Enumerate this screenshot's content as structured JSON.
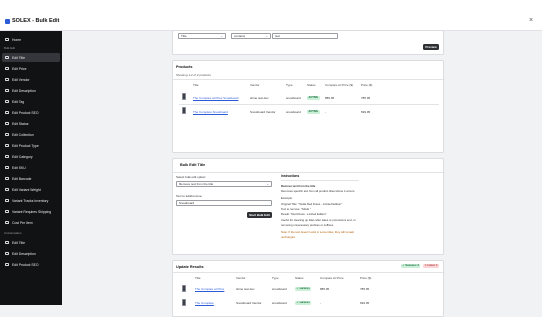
{
  "app": {
    "title": "SOLEX - Bulk Edit",
    "close_glyph": "×"
  },
  "sidebar": {
    "sections": [
      {
        "label": "Bulk Edit"
      },
      {
        "label": "AI Automation"
      }
    ],
    "items": [
      {
        "label": "Home",
        "icon": "home-icon"
      },
      {
        "label": "Edit Title",
        "icon": "edit-icon",
        "active": true
      },
      {
        "label": "Edit Price",
        "icon": "price-tag-icon"
      },
      {
        "label": "Edit Vendor",
        "icon": "vendor-icon"
      },
      {
        "label": "Edit Description",
        "icon": "description-icon"
      },
      {
        "label": "Edit Tag",
        "icon": "tag-icon"
      },
      {
        "label": "Edit Product SEO",
        "icon": "seo-icon"
      },
      {
        "label": "Edit Status",
        "icon": "status-icon"
      },
      {
        "label": "Edit Collection",
        "icon": "collection-icon"
      },
      {
        "label": "Edit Product Type",
        "icon": "product-type-icon"
      },
      {
        "label": "Edit Category",
        "icon": "category-icon"
      },
      {
        "label": "Edit SKU",
        "icon": "sku-icon"
      },
      {
        "label": "Edit Barcode",
        "icon": "barcode-icon"
      },
      {
        "label": "Edit Variant Weight",
        "icon": "weight-icon"
      },
      {
        "label": "Variant Tracks Inventory",
        "icon": "inventory-icon"
      },
      {
        "label": "Variant Requires Shipping",
        "icon": "shipping-icon"
      },
      {
        "label": "Cost Per Item",
        "icon": "cost-icon"
      },
      {
        "label": "Edit Title",
        "icon": "edit-icon"
      },
      {
        "label": "Edit Description",
        "icon": "description-icon"
      },
      {
        "label": "Edit Product SEO",
        "icon": "seo-icon"
      }
    ]
  },
  "filter": {
    "field": "Title",
    "operator": "contains",
    "value": "test",
    "preview_label": "Preview"
  },
  "products": {
    "title": "Products",
    "summary": "Showing 1-2 of 2 products",
    "columns": [
      "Title",
      "Vendor",
      "Type",
      "Status",
      "Compare At Price ($)",
      "Price ($)"
    ],
    "rows": [
      {
        "title": "The Compare at Price Snowboard",
        "vendor": "shine test dev",
        "type": "snowboard",
        "status": "ACTIVE",
        "compare": "885.95",
        "price": "785.95"
      },
      {
        "title": "The Complete Snowboard",
        "vendor": "Snowboard Vendor",
        "type": "snowboard",
        "status": "ACTIVE",
        "compare": "-",
        "price": "699.95"
      }
    ]
  },
  "bulk": {
    "title": "Bulk Edit Title",
    "option_label": "Select bulk edit option:",
    "option_value": "Remove text from the title",
    "text_label": "Text to add/remove:",
    "text_value": "Snowboard",
    "start_label": "Start Bulk Edit",
    "instructions_title": "Instructions",
    "instructions": [
      "Remove text from the title",
      "Removes specific text from all product titles where it occurs.",
      "Example:",
      "Original Title: \"SALE Red Dress - Limited Edition\"",
      "Text to remove: \"SALE \"",
      "Result: \"Red Dress - Limited Edition\"",
      "Useful for cleaning up titles after sales or promotions end, or",
      "removing unnecessary prefixes or suffixes."
    ],
    "note": "Note: If the text doesn't exist in some titles, they will remain",
    "note2": "unchanged."
  },
  "results": {
    "title": "Update Results",
    "success_badge": "✓ Success: 2",
    "failed_badge": "✕ Failed: 0",
    "columns": [
      "Title",
      "Vendor",
      "Type",
      "Status",
      "Compare At Price",
      "Price ($)"
    ],
    "rows": [
      {
        "title": "The Compare at Price",
        "vendor": "shine test dev",
        "type": "snowboard",
        "status": "✓ success",
        "compare": "885.95",
        "price": "785.95"
      },
      {
        "title": "The Complete",
        "vendor": "Snowboard Vendor",
        "type": "snowboard",
        "status": "✓ success",
        "compare": "-",
        "price": "699.95"
      }
    ]
  },
  "colors": {
    "sidebar_bg": "#111214",
    "accent": "#2b5bd7",
    "success_bg": "#c9f0d6",
    "failed_bg": "#fbd5d5"
  }
}
